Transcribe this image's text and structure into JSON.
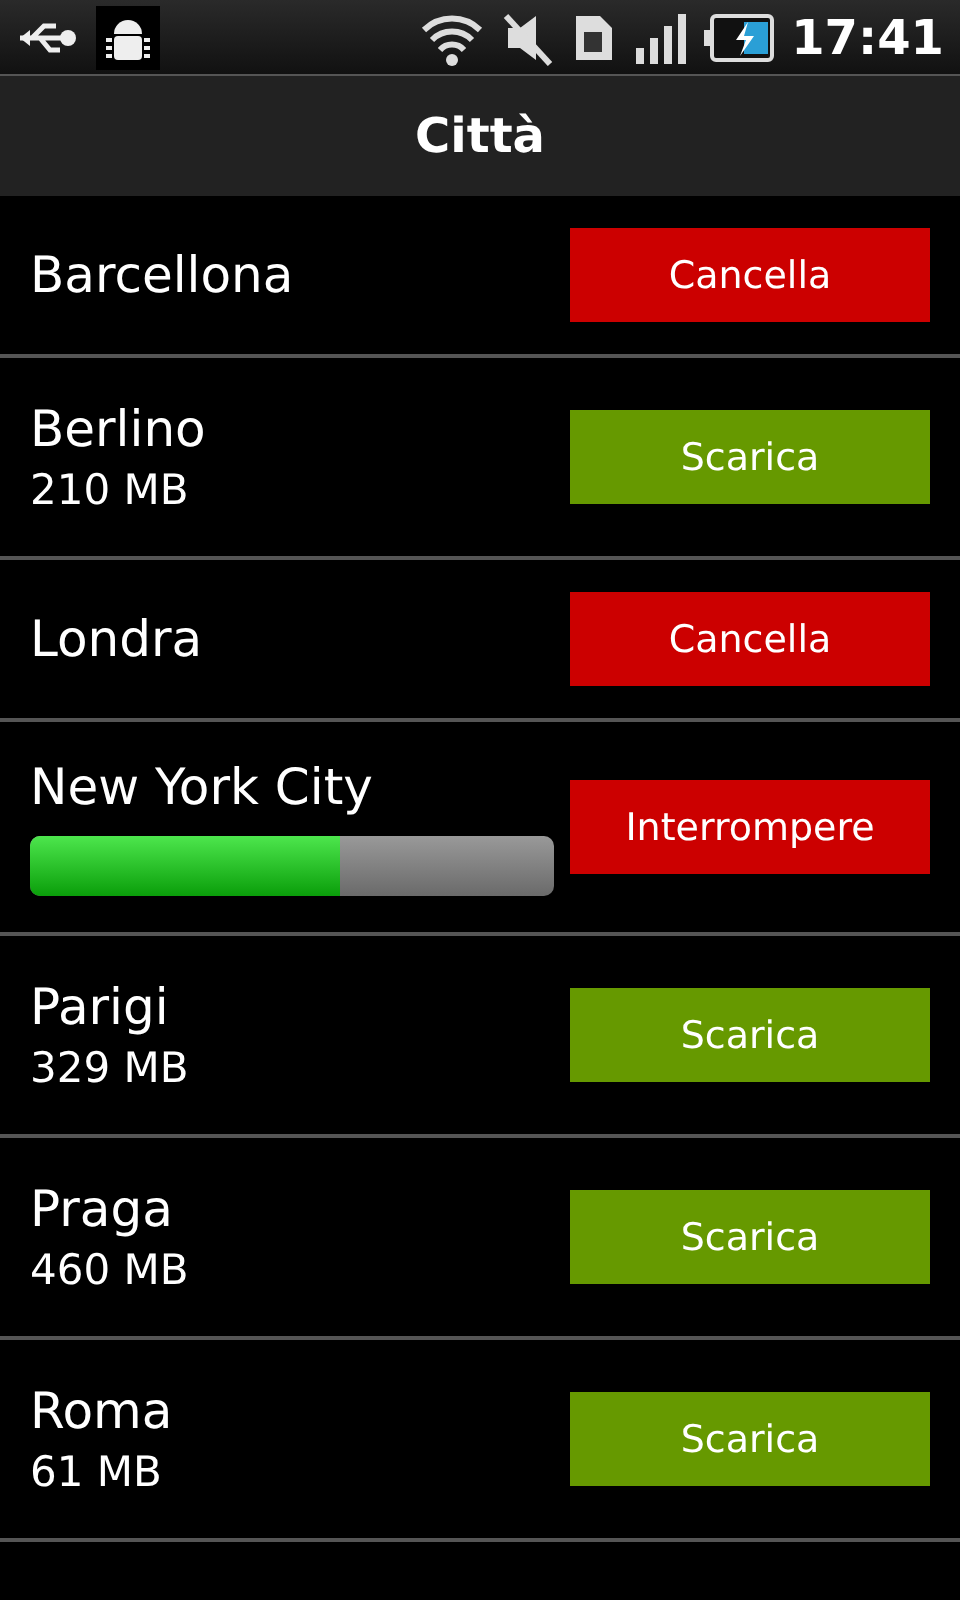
{
  "status_bar": {
    "time": "17:41"
  },
  "title": "Città",
  "cities": [
    {
      "name": "Barcellona",
      "action": {
        "label": "Cancella",
        "kind": "cancel"
      }
    },
    {
      "name": "Berlino",
      "size": "210 MB",
      "action": {
        "label": "Scarica",
        "kind": "download"
      }
    },
    {
      "name": "Londra",
      "action": {
        "label": "Cancella",
        "kind": "cancel"
      }
    },
    {
      "name": "New York City",
      "level": 0.59,
      "action": {
        "label": "Interrompere",
        "kind": "stop"
      }
    },
    {
      "name": "Parigi",
      "size": "329 MB",
      "action": {
        "label": "Scarica",
        "kind": "download"
      }
    },
    {
      "name": "Praga",
      "size": "460 MB",
      "action": {
        "label": "Scarica",
        "kind": "download"
      }
    },
    {
      "name": "Roma",
      "size": "61 MB",
      "action": {
        "label": "Scarica",
        "kind": "download"
      }
    }
  ]
}
